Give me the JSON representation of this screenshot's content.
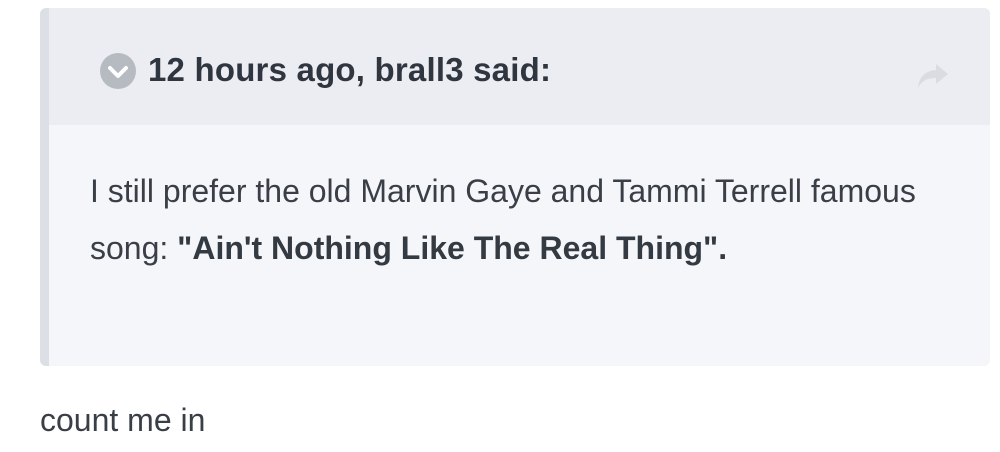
{
  "quote": {
    "citation": "12 hours ago, brall3 said:",
    "toggle_icon": "chevron-down-circle",
    "share_icon": "share-arrow",
    "text_lead": " I still prefer the old Marvin Gaye and Tammi Terrell famous song:  ",
    "text_bold": "\"Ain't Nothing Like The Real Thing\"."
  },
  "reply": {
    "text": "count me in"
  },
  "colors": {
    "quote_bg": "#f4f6fa",
    "header_bg": "#ecedf2",
    "border": "#dcdfe5",
    "text": "#2f3640",
    "icon": "#b6bac1"
  }
}
